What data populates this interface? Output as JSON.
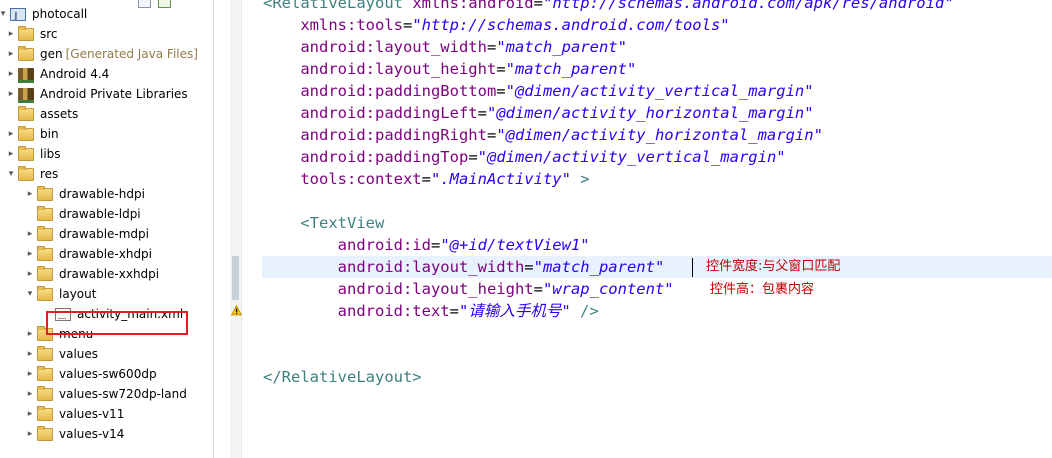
{
  "explorer": {
    "toolbar": [
      {
        "icon": "collapse-all-icon"
      },
      {
        "icon": "link-with-editor-icon"
      }
    ],
    "tree": [
      {
        "label": "photocall",
        "decoration": "",
        "icon": "project-icon",
        "arrow": "▾"
      },
      {
        "label": "src",
        "decoration": "",
        "icon": "source-folder-icon",
        "arrow": "▸"
      },
      {
        "label": "gen",
        "decoration": "[Generated Java Files]",
        "icon": "source-folder-icon",
        "arrow": "▸"
      },
      {
        "label": "Android 4.4",
        "decoration": "",
        "icon": "library-icon",
        "arrow": "▸"
      },
      {
        "label": "Android Private Libraries",
        "decoration": "",
        "icon": "library-icon",
        "arrow": "▸"
      },
      {
        "label": "assets",
        "decoration": "",
        "icon": "folder-icon",
        "arrow": ""
      },
      {
        "label": "bin",
        "decoration": "",
        "icon": "folder-icon",
        "arrow": "▸"
      },
      {
        "label": "libs",
        "decoration": "",
        "icon": "folder-icon",
        "arrow": "▸"
      },
      {
        "label": "res",
        "decoration": "",
        "icon": "folder-icon",
        "arrow": "▾"
      },
      {
        "label": "drawable-hdpi",
        "decoration": "",
        "icon": "folder-icon",
        "arrow": "▸"
      },
      {
        "label": "drawable-ldpi",
        "decoration": "",
        "icon": "folder-icon",
        "arrow": ""
      },
      {
        "label": "drawable-mdpi",
        "decoration": "",
        "icon": "folder-icon",
        "arrow": "▸"
      },
      {
        "label": "drawable-xhdpi",
        "decoration": "",
        "icon": "folder-icon",
        "arrow": "▸"
      },
      {
        "label": "drawable-xxhdpi",
        "decoration": "",
        "icon": "folder-icon",
        "arrow": "▸"
      },
      {
        "label": "layout",
        "decoration": "",
        "icon": "folder-icon",
        "arrow": "▾"
      },
      {
        "label": "activity_main.xml",
        "decoration": "",
        "icon": "xml-file-icon",
        "arrow": ""
      },
      {
        "label": "menu",
        "decoration": "",
        "icon": "folder-icon",
        "arrow": "▸"
      },
      {
        "label": "values",
        "decoration": "",
        "icon": "folder-icon",
        "arrow": "▸"
      },
      {
        "label": "values-sw600dp",
        "decoration": "",
        "icon": "folder-icon",
        "arrow": "▸"
      },
      {
        "label": "values-sw720dp-land",
        "decoration": "",
        "icon": "folder-icon",
        "arrow": "▸"
      },
      {
        "label": "values-v11",
        "decoration": "",
        "icon": "folder-icon",
        "arrow": "▸"
      },
      {
        "label": "values-v14",
        "decoration": "",
        "icon": "folder-icon",
        "arrow": "▸"
      }
    ],
    "selected": "activity_main.xml"
  },
  "editor": {
    "lines": [
      [
        [
          "tag",
          "<RelativeLayout "
        ],
        [
          "attr",
          "xmlns:android"
        ],
        [
          "punct",
          "="
        ],
        [
          "val",
          "\"http://schemas.android.com/apk/res/android\""
        ]
      ],
      [
        [
          "attr",
          "    xmlns:tools"
        ],
        [
          "punct",
          "="
        ],
        [
          "val",
          "\"http://schemas.android.com/tools\""
        ]
      ],
      [
        [
          "attr",
          "    android:layout_width"
        ],
        [
          "punct",
          "="
        ],
        [
          "val",
          "\"match_parent\""
        ]
      ],
      [
        [
          "attr",
          "    android:layout_height"
        ],
        [
          "punct",
          "="
        ],
        [
          "val",
          "\"match_parent\""
        ]
      ],
      [
        [
          "attr",
          "    android:paddingBottom"
        ],
        [
          "punct",
          "="
        ],
        [
          "val",
          "\"@dimen/activity_vertical_margin\""
        ]
      ],
      [
        [
          "attr",
          "    android:paddingLeft"
        ],
        [
          "punct",
          "="
        ],
        [
          "val",
          "\"@dimen/activity_horizontal_margin\""
        ]
      ],
      [
        [
          "attr",
          "    android:paddingRight"
        ],
        [
          "punct",
          "="
        ],
        [
          "val",
          "\"@dimen/activity_horizontal_margin\""
        ]
      ],
      [
        [
          "attr",
          "    android:paddingTop"
        ],
        [
          "punct",
          "="
        ],
        [
          "val",
          "\"@dimen/activity_vertical_margin\""
        ]
      ],
      [
        [
          "attr",
          "    tools:context"
        ],
        [
          "punct",
          "="
        ],
        [
          "val",
          "\".MainActivity\""
        ],
        [
          "tag",
          " >"
        ]
      ],
      [],
      [
        [
          "tag",
          "    <TextView"
        ]
      ],
      [
        [
          "attr",
          "        android:id"
        ],
        [
          "punct",
          "="
        ],
        [
          "val",
          "\"@+id/textView1\""
        ]
      ],
      [
        [
          "attr",
          "        android:layout_width"
        ],
        [
          "punct",
          "="
        ],
        [
          "val",
          "\"match_parent\""
        ]
      ],
      [
        [
          "attr",
          "        android:layout_height"
        ],
        [
          "punct",
          "="
        ],
        [
          "val",
          "\"wrap_content\""
        ]
      ],
      [
        [
          "attr",
          "        android:text"
        ],
        [
          "punct",
          "="
        ],
        [
          "val",
          "\"请输入手机号\""
        ],
        [
          "tag",
          " />"
        ]
      ],
      [],
      [],
      [
        [
          "tag",
          "</RelativeLayout>"
        ]
      ]
    ],
    "annotations": {
      "width_note": "控件宽度:与父窗口匹配",
      "height_note": "控件高：包裹内容"
    }
  }
}
